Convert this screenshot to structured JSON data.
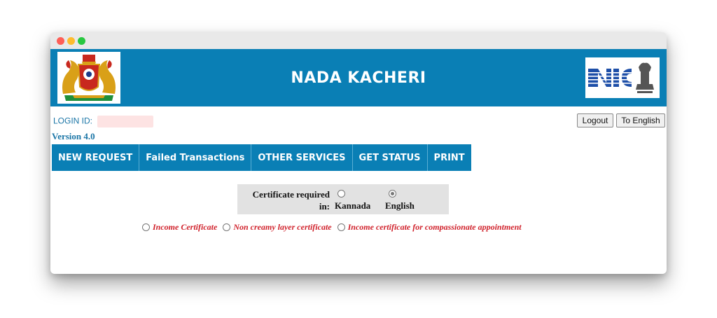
{
  "window": {
    "controls": [
      "close",
      "minimize",
      "maximize"
    ]
  },
  "header": {
    "title": "NADA KACHERI",
    "left_logo": "karnataka-emblem-icon",
    "right_logo": "nic-emblem-icon"
  },
  "user": {
    "login_label": "LOGIN ID:",
    "version": "Version 4.0"
  },
  "toolbar": {
    "logout_label": "Logout",
    "language_label": "To English"
  },
  "nav": {
    "items": [
      {
        "label": "NEW REQUEST"
      },
      {
        "label": "Failed Transactions"
      },
      {
        "label": "OTHER SERVICES"
      },
      {
        "label": "GET STATUS"
      },
      {
        "label": "PRINT"
      }
    ]
  },
  "certificate_language": {
    "label": "Certificate required in:",
    "options": [
      {
        "label": "Kannada",
        "selected": false
      },
      {
        "label": "English",
        "selected": true
      }
    ]
  },
  "certificate_types": [
    {
      "label": "Income Certificate"
    },
    {
      "label": "Non creamy layer certificate"
    },
    {
      "label": "Income certificate for compassionate appointment"
    }
  ],
  "colors": {
    "brand_blue": "#0a7fb5",
    "option_red": "#d0202a",
    "link_blue": "#1a75a6"
  }
}
